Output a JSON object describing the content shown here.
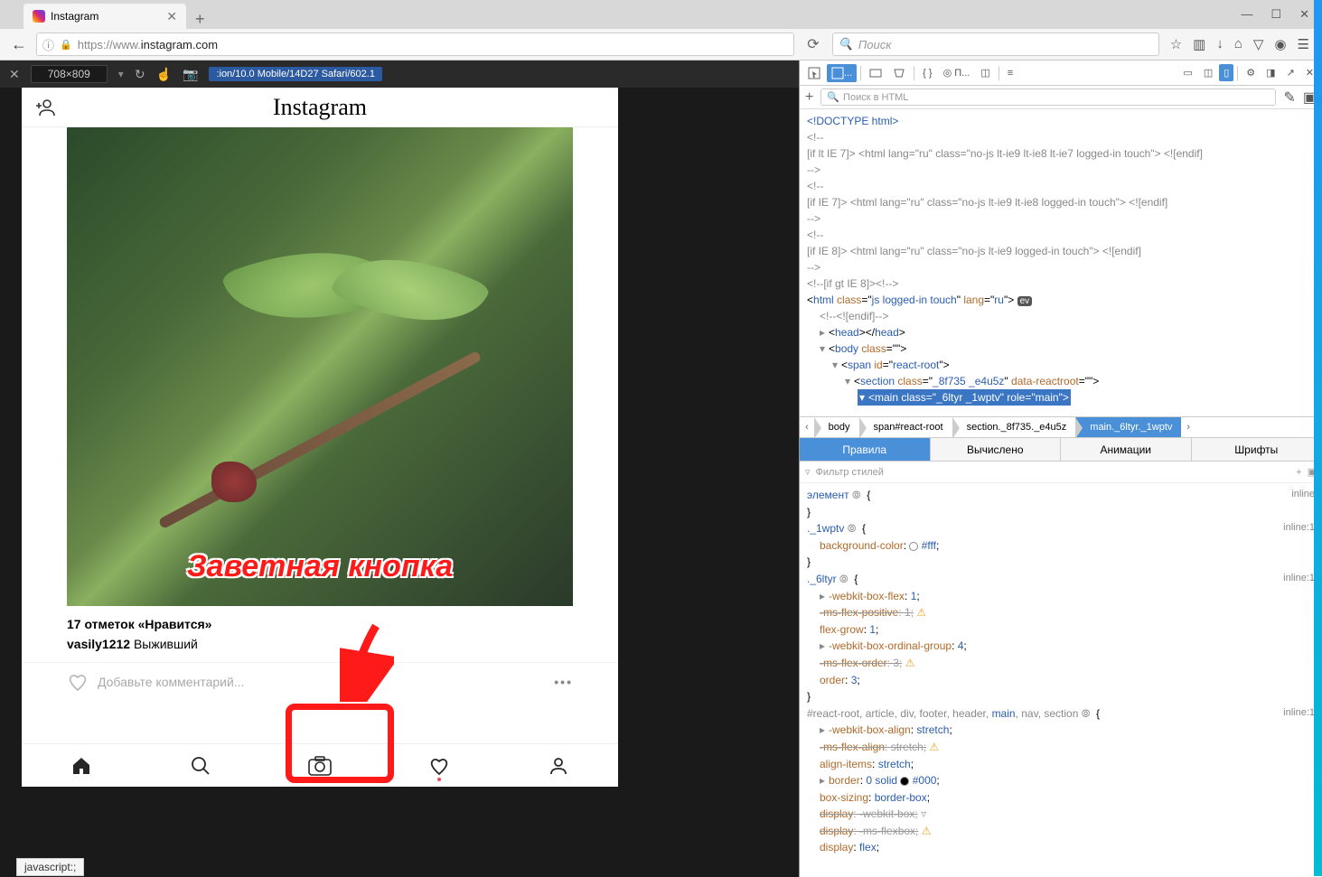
{
  "browser": {
    "tab_title": "Instagram",
    "url_prefix": "https://www.",
    "url_host": "instagram.com",
    "search_placeholder": "Поиск",
    "status_bar": "javascript:;"
  },
  "rdm": {
    "dimensions": "708×809",
    "user_agent": ":ion/10.0 Mobile/14D27 Safari/602.1"
  },
  "instagram": {
    "logo": "Instagram",
    "overlay_text": "Заветная кнопка",
    "likes": "17 отметок «Нравится»",
    "username": "vasily1212",
    "caption": "Выживший",
    "comment_placeholder": "Добавьте комментарий..."
  },
  "devtools": {
    "search_html_placeholder": "Поиск в HTML",
    "html": {
      "l1": "<!DOCTYPE html>",
      "l2": "<!--",
      "l3": "[if lt IE 7]> <html lang=\"ru\" class=\"no-js lt-ie9 lt-ie8 lt-ie7 logged-in touch\"> <![endif]",
      "l4": "-->",
      "l5": "<!--",
      "l6": "[if IE 7]> <html lang=\"ru\" class=\"no-js lt-ie9 lt-ie8 logged-in touch\"> <![endif]",
      "l7": "-->",
      "l8": "<!--",
      "l9": "[if IE 8]> <html lang=\"ru\" class=\"no-js lt-ie9 logged-in touch\"> <![endif]",
      "l10": "-->",
      "l11": "<!--[if gt IE 8]><!-->",
      "l12a": "html",
      "l12b": "class",
      "l12c": "js logged-in touch",
      "l12d": "lang",
      "l12e": "ru",
      "l13": "<!--<![endif]-->",
      "l14a": "head",
      "l15a": "body",
      "l15b": "class",
      "l16a": "span",
      "l16b": "id",
      "l16c": "react-root",
      "l17a": "section",
      "l17b": "class",
      "l17c": "_8f735 _e4u5z",
      "l17d": "data-reactroot",
      "l18a": "main",
      "l18b": "class",
      "l18c": "_6ltyr _1wptv",
      "l18d": "role",
      "l18e": "main"
    },
    "breadcrumb": {
      "b1": "body",
      "b2": "span#react-root",
      "b3": "section._8f735._e4u5z",
      "b4": "main._6ltyr._1wptv"
    },
    "styles_tabs": {
      "t1": "Правила",
      "t2": "Вычислено",
      "t3": "Анимации",
      "t4": "Шрифты"
    },
    "filter_placeholder": "Фильтр стилей",
    "styles": {
      "r1_sel": "элемент",
      "r1_src": "inline",
      "r2_sel": "._1wptv",
      "r2_src": "inline:1",
      "r2_p1n": "background-color",
      "r2_p1v": "#fff",
      "r3_sel": "._6ltyr",
      "r3_src": "inline:1",
      "r3_p1n": "-webkit-box-flex",
      "r3_p1v": "1",
      "r3_p2n": "-ms-flex-positive",
      "r3_p2v": "1",
      "r3_p3n": "flex-grow",
      "r3_p3v": "1",
      "r3_p4n": "-webkit-box-ordinal-group",
      "r3_p4v": "4",
      "r3_p5n": "-ms-flex-order",
      "r3_p5v": "3",
      "r3_p6n": "order",
      "r3_p6v": "3",
      "r4_sel": "#react-root, article, div, footer, header, main, nav, section",
      "r4_src": "inline:1",
      "r4_p1n": "-webkit-box-align",
      "r4_p1v": "stretch",
      "r4_p2n": "-ms-flex-align",
      "r4_p2v": "stretch",
      "r4_p3n": "align-items",
      "r4_p3v": "stretch",
      "r4_p4n": "border",
      "r4_p4v": "0 solid #000",
      "r4_p5n": "box-sizing",
      "r4_p5v": "border-box",
      "r4_p6n": "display",
      "r4_p6v": "-webkit-box",
      "r4_p7n": "display",
      "r4_p7v": "-ms-flexbox",
      "r4_p8n": "display",
      "r4_p8v": "flex"
    }
  }
}
